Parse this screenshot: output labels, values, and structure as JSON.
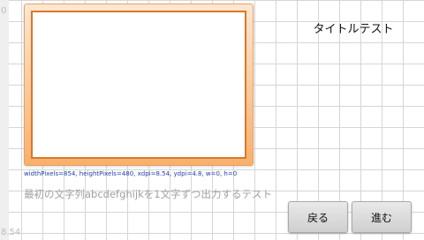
{
  "axis": {
    "top_value": "0",
    "bottom_value": "8.54"
  },
  "header": {
    "title": "タイトルテスト"
  },
  "debug": {
    "info": "widthPixels=854, heightPixels=480, xdpi=8.54, ydpi=4.8, w=0, h=0"
  },
  "body": {
    "message": "最初の文字列abcdefghijkを1文字ずつ出力するテスト"
  },
  "buttons": {
    "back_label": "戻る",
    "next_label": "進む"
  }
}
